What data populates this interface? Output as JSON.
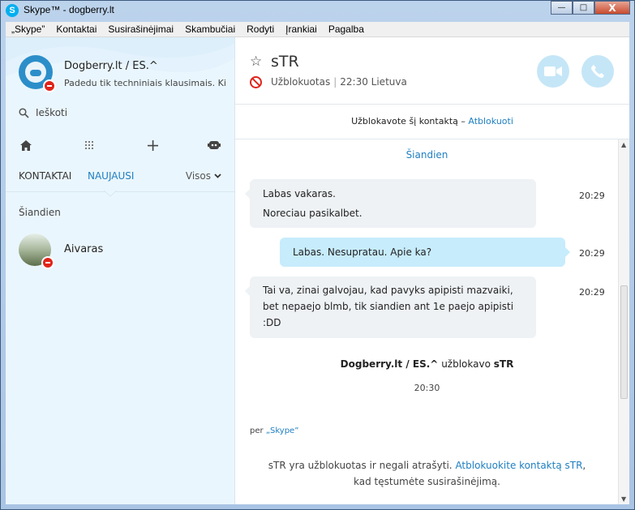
{
  "window": {
    "title": "Skype™ - dogberry.lt",
    "logo_letter": "S",
    "controls": {
      "minimize": "—",
      "maximize": "□",
      "close": "X"
    }
  },
  "menu": [
    "„Skype”",
    "Kontaktai",
    "Susirašinėjimai",
    "Skambučiai",
    "Rodyti",
    "Įrankiai",
    "Pagalba"
  ],
  "profile": {
    "name": "Dogberry.lt / ES.^",
    "mood": "Padedu tik techniniais klausimais. Ki...",
    "status": "blocked"
  },
  "search": {
    "label": "Ieškoti"
  },
  "tabs": {
    "contacts": "KONTAKTAI",
    "recent": "NAUJAUSI",
    "filter": "Visos"
  },
  "recent": {
    "section": "Šiandien",
    "contacts": [
      {
        "name": "Aivaras",
        "status": "blocked"
      }
    ]
  },
  "chat": {
    "name": "sTR",
    "status": "Užblokuotas",
    "local_time": "22:30 Lietuva",
    "block_notice": "Užblokavote šį kontaktą –",
    "unblock_link": "Atblokuoti",
    "day_label": "Šiandien",
    "messages": [
      {
        "direction": "in",
        "lines": [
          "Labas vakaras.",
          "Noreciau pasikalbet."
        ],
        "time": "20:29"
      },
      {
        "direction": "out",
        "lines": [
          "Labas. Nesupratau. Apie ka?"
        ],
        "time": "20:29"
      },
      {
        "direction": "in",
        "lines": [
          "Tai va, zinai galvojau, kad pavyks apipisti mazvaiki,",
          "bet nepaejo blmb, tik siandien ant 1e paejo apipisti",
          ":DD"
        ],
        "time": "20:29"
      }
    ],
    "system": {
      "actor": "Dogberry.lt / ES.^",
      "action": "užblokavo",
      "target": "sTR",
      "time": "20:30"
    },
    "via_prefix": "per",
    "via_link": "„Skype”",
    "footer_text_1": "sTR yra užblokuotas ir negali atrašyti.",
    "footer_link": "Atblokuokite kontaktą sTR",
    "footer_text_2": ", kad tęstumėte susirašinėjimą."
  },
  "colors": {
    "accent": "#1f7fc1",
    "skype_blue": "#00aff0",
    "blocked_red": "#e0241a",
    "bubble_in": "#eef2f5",
    "bubble_out": "#c7ecfc"
  }
}
